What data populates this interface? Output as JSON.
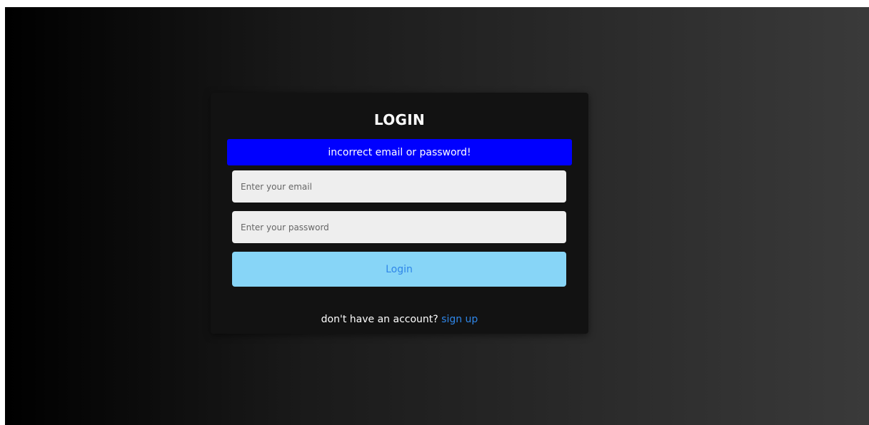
{
  "login": {
    "title": "LOGIN",
    "error_message": "incorrect email or password!",
    "email_placeholder": "Enter your email",
    "password_placeholder": "Enter your password",
    "submit_label": "Login",
    "signup_prompt": "don't have an account?",
    "signup_link": "sign up"
  },
  "colors": {
    "error_banner": "#0000ff",
    "login_button": "#87d5f7",
    "link": "#2f86e8",
    "card": "#121212"
  }
}
